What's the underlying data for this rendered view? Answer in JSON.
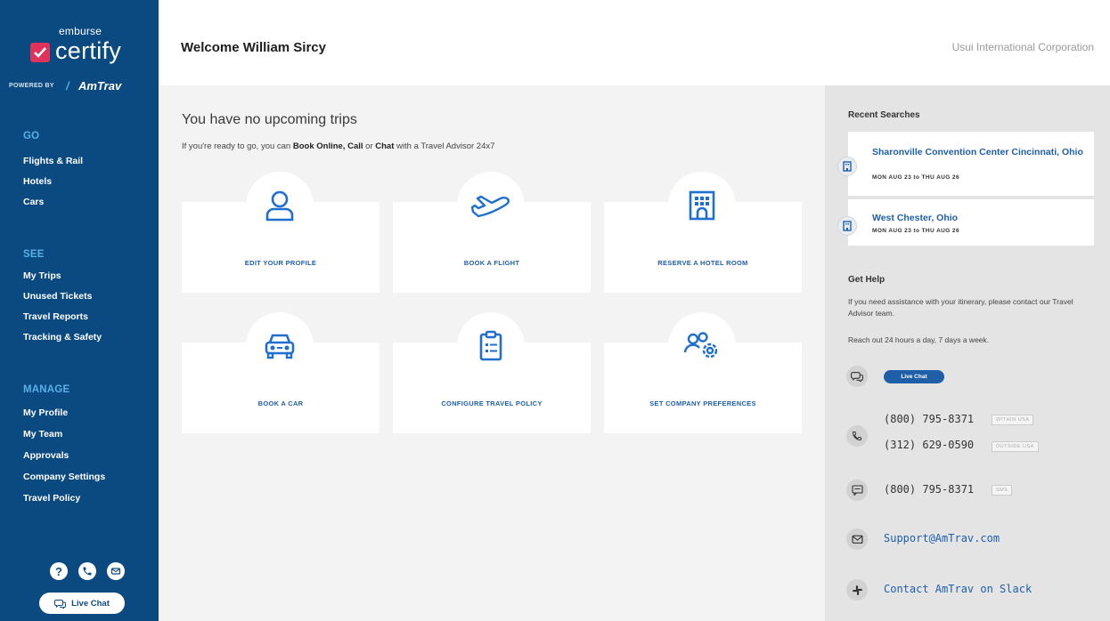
{
  "sidebar": {
    "brand": {
      "top": "emburse",
      "name": "certify",
      "powered_by": "POWERED BY",
      "partner": "AmTrav"
    },
    "sections": {
      "go": {
        "label": "GO",
        "items": [
          "Flights & Rail",
          "Hotels",
          "Cars"
        ]
      },
      "see": {
        "label": "SEE",
        "items": [
          "My Trips",
          "Unused Tickets",
          "Travel Reports",
          "Tracking & Safety"
        ]
      },
      "manage": {
        "label": "MANAGE",
        "items": [
          "My Profile",
          "My Team",
          "Approvals",
          "Company Settings",
          "Travel Policy"
        ]
      }
    },
    "icons": {
      "help": "?",
      "phone": "phone-icon",
      "email": "email-icon"
    },
    "live_chat_label": "Live Chat"
  },
  "header": {
    "welcome": "Welcome William Sircy",
    "company": "Usui International Corporation"
  },
  "main": {
    "no_trips_title": "You have no upcoming trips",
    "ready_line": {
      "prefix": "If you're ready to go, you can ",
      "book_online": "Book Online,",
      "call": "Call",
      "or": " or ",
      "chat": "Chat",
      "suffix": " with a Travel Advisor 24x7"
    },
    "cards": [
      {
        "label": "EDIT YOUR PROFILE",
        "icon": "user-icon"
      },
      {
        "label": "BOOK A FLIGHT",
        "icon": "airplane-icon"
      },
      {
        "label": "RESERVE A HOTEL ROOM",
        "icon": "hotel-icon"
      },
      {
        "label": "BOOK A CAR",
        "icon": "car-icon"
      },
      {
        "label": "CONFIGURE TRAVEL POLICY",
        "icon": "clipboard-icon"
      },
      {
        "label": "SET COMPANY PREFERENCES",
        "icon": "users-gear-icon"
      }
    ]
  },
  "right_panel": {
    "recent_title": "Recent Searches",
    "recent": [
      {
        "name": "Sharonville Convention Center Cincinnati, Ohio",
        "dates": "MON AUG 23 to THU AUG 26"
      },
      {
        "name": "West Chester, Ohio",
        "dates": "MON AUG 23 to THU AUG 26"
      }
    ],
    "help_title": "Get Help",
    "help_text": "If you need assistance with your itinerary, please contact our Travel Advisor team.",
    "reach_text": "Reach out 24 hours a day, 7 days a week.",
    "live_chat_label": "Live Chat",
    "phones": [
      {
        "number": "(800) 795-8371",
        "tag": "WITHIN USA"
      },
      {
        "number": "(312) 629-0590",
        "tag": "OUTSIDE USA"
      }
    ],
    "sms": {
      "number": "(800) 795-8371",
      "tag": "SMS"
    },
    "email": "Support@AmTrav.com",
    "slack": "Contact AmTrav on Slack"
  },
  "colors": {
    "sidebar": "#0b4a80",
    "accent": "#1f5fa8",
    "section": "#58b0e8",
    "brand_check": "#e0325a"
  }
}
